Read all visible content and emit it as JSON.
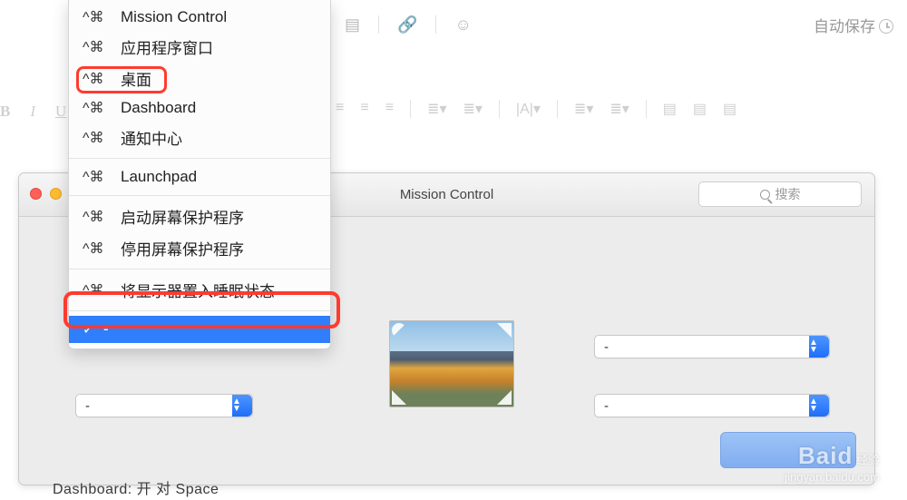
{
  "editor": {
    "auto_save": "自动保存",
    "fmt": {
      "b": "B",
      "i": "I",
      "u": "U"
    }
  },
  "menu": {
    "shortcut": "^⌘",
    "items": [
      {
        "label": "Mission Control"
      },
      {
        "label": "应用程序窗口"
      },
      {
        "label": "桌面",
        "highlighted": true
      },
      {
        "label": "Dashboard"
      },
      {
        "label": "通知中心"
      }
    ],
    "group2": [
      {
        "label": "Launchpad"
      }
    ],
    "group3": [
      {
        "label": "启动屏幕保护程序"
      },
      {
        "label": "停用屏幕保护程序"
      }
    ],
    "group4": [
      {
        "label": "将显示器置入睡眠状态"
      }
    ],
    "selected": {
      "label": "-",
      "check": "✓"
    }
  },
  "pref": {
    "title": "Mission Control",
    "search_placeholder": "搜索",
    "selects": {
      "s1": "-",
      "s2": "-",
      "s3": "-"
    },
    "arrows": "▲\n▼"
  },
  "bottom_cut": "Dashboard:     开 对 Space",
  "watermark": {
    "brand": "Baid",
    "suffix": "经验",
    "url": "jingyan.baidu.com"
  }
}
